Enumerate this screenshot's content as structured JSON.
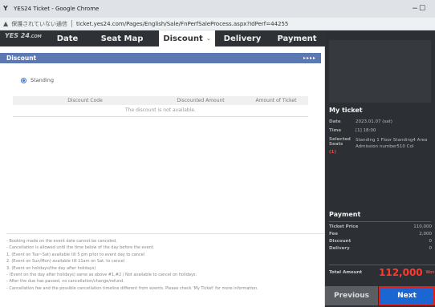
{
  "window": {
    "title": "YES24 Ticket - Google Chrome",
    "app_icon": "Y",
    "minimize": "−",
    "maximize": "☐"
  },
  "address_bar": {
    "warning_icon": "▲",
    "insecure_text": "保護されていない通信",
    "url": "ticket.yes24.com/Pages/English/Sale/FnPerfSaleProcess.aspx?IdPerf=44255"
  },
  "nav": {
    "logo_main": "YES 24",
    "logo_suffix": ".COM",
    "tabs": [
      {
        "label": "Date"
      },
      {
        "label": "Seat Map"
      },
      {
        "label": "Discount",
        "chevron": "⌄"
      },
      {
        "label": "Delivery"
      },
      {
        "label": "Payment"
      }
    ]
  },
  "discount": {
    "section_title": "Discount",
    "arrows": "▸▸▸▸",
    "radio_label": "Standing",
    "table": {
      "headers": [
        "Discount Code",
        "Discounted Amount",
        "Amount of Ticket"
      ],
      "empty_message": "The discount is not available."
    }
  },
  "notes": [
    "- Booking made on the event date cannot be canceled.",
    "- Cancellation is allowed until the time below of the day before the event.",
    "  1. (Event on Tue~Sat) available till 5 pm prior to event day to cancel",
    "  2. (Event on Sun/Mon) available till 11am on Sat. to cancel",
    "  3. (Event on holidays/the day after holidays)",
    "  - (Event on the day after holidays) same as above #1,#2 / Not available to cancel on holidays.",
    "- After the due has passed, no cancellation/change/refund.",
    "- Cancellation fee and the possible cancellation timeline different from events. Please check 'My Ticket' for more information."
  ],
  "sidebar": {
    "my_ticket_heading": "My ticket",
    "date_label": "Date",
    "date_value": "2023.01.07 (sat)",
    "time_label": "Time",
    "time_value": "[1] 18:00",
    "seats_label": "Selected Seats",
    "seats_value": "Standing 1 Floor Standing4 Area Admission number510 Col",
    "seat_count": "(1)",
    "payment_heading": "Payment",
    "ticket_price_label": "Ticket Price",
    "ticket_price_value": "110,000",
    "fee_label": "Fee",
    "fee_value": "2,000",
    "discount_label": "Discount",
    "discount_value": "0",
    "delivery_label": "Delivery",
    "delivery_value": "0",
    "total_label": "Total Amount",
    "total_value": "112,000",
    "total_unit": "Won",
    "prev_button": "Previous",
    "next_button": "Next"
  },
  "colors": {
    "section_bar": "#5c78b3",
    "next_button": "#1b66d2",
    "total_amount": "#ff3b30",
    "highlight_border": "#e0201c"
  }
}
